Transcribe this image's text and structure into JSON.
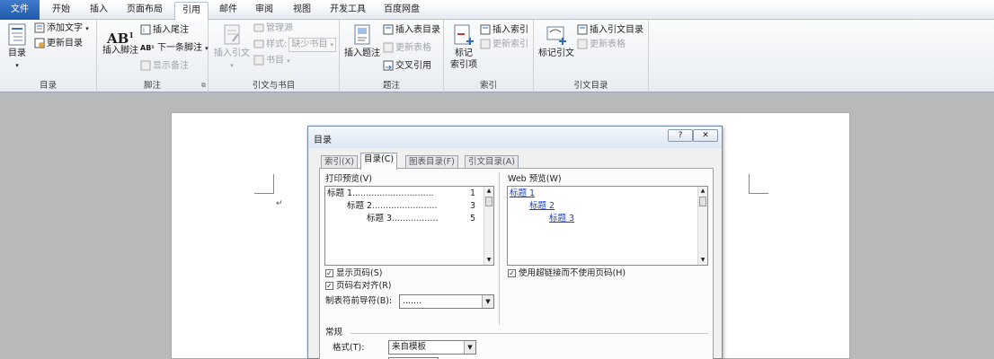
{
  "tabs": [
    "文件",
    "开始",
    "插入",
    "页面布局",
    "引用",
    "邮件",
    "审阅",
    "视图",
    "开发工具",
    "百度网盘"
  ],
  "active_tab": "引用",
  "ribbon": {
    "groups": {
      "toc": "目录",
      "footnotes": "脚注",
      "citations": "引文与书目",
      "captions": "题注",
      "index": "索引",
      "authorities": "引文目录"
    },
    "toc_button": "目录",
    "add_text": "添加文字",
    "update_toc": "更新目录",
    "insert_footnote": "插入脚注",
    "insert_endnote": "插入尾注",
    "next_footnote": "下一条脚注",
    "show_notes": "显示备注",
    "insert_citation": "插入引文",
    "manage_sources": "管理源",
    "style_label": "样式:",
    "style_value": "缺少书目",
    "bibliography": "书目",
    "insert_caption": "插入题注",
    "insert_table_of_figures": "插入表目录",
    "update_table": "更新表格",
    "cross_reference": "交叉引用",
    "mark_entry_1": "标记",
    "mark_entry_2": "索引项",
    "insert_index": "插入索引",
    "update_index": "更新索引",
    "mark_citation": "标记引文",
    "insert_table_of_authorities": "插入引文目录",
    "update_table2": "更新表格"
  },
  "doc": {
    "para_mark": "↵"
  },
  "dialog": {
    "title": "目录",
    "help": "?",
    "close": "✕",
    "tabs": [
      "索引(X)",
      "目录(C)",
      "图表目录(F)",
      "引文目录(A)"
    ],
    "print_preview_label": "打印预览(V)",
    "print_preview": [
      {
        "text": "标题 1",
        "page": "1"
      },
      {
        "text": "标题 2",
        "page": "3"
      },
      {
        "text": "标题 3",
        "page": "5"
      }
    ],
    "web_preview_label": "Web 预览(W)",
    "web_preview": [
      "标题 1",
      "标题 2",
      "标题 3"
    ],
    "show_page_numbers": "显示页码(S)",
    "right_align": "页码右对齐(R)",
    "tab_leader_label": "制表符前导符(B):",
    "tab_leader_value": ".......",
    "use_hyperlinks": "使用超链接而不使用页码(H)",
    "general_label": "常规",
    "format_label": "格式(T):",
    "format_value": "来自模板",
    "colors": {
      "accent": "#1f5aa9",
      "link": "#1a3fc6"
    }
  }
}
